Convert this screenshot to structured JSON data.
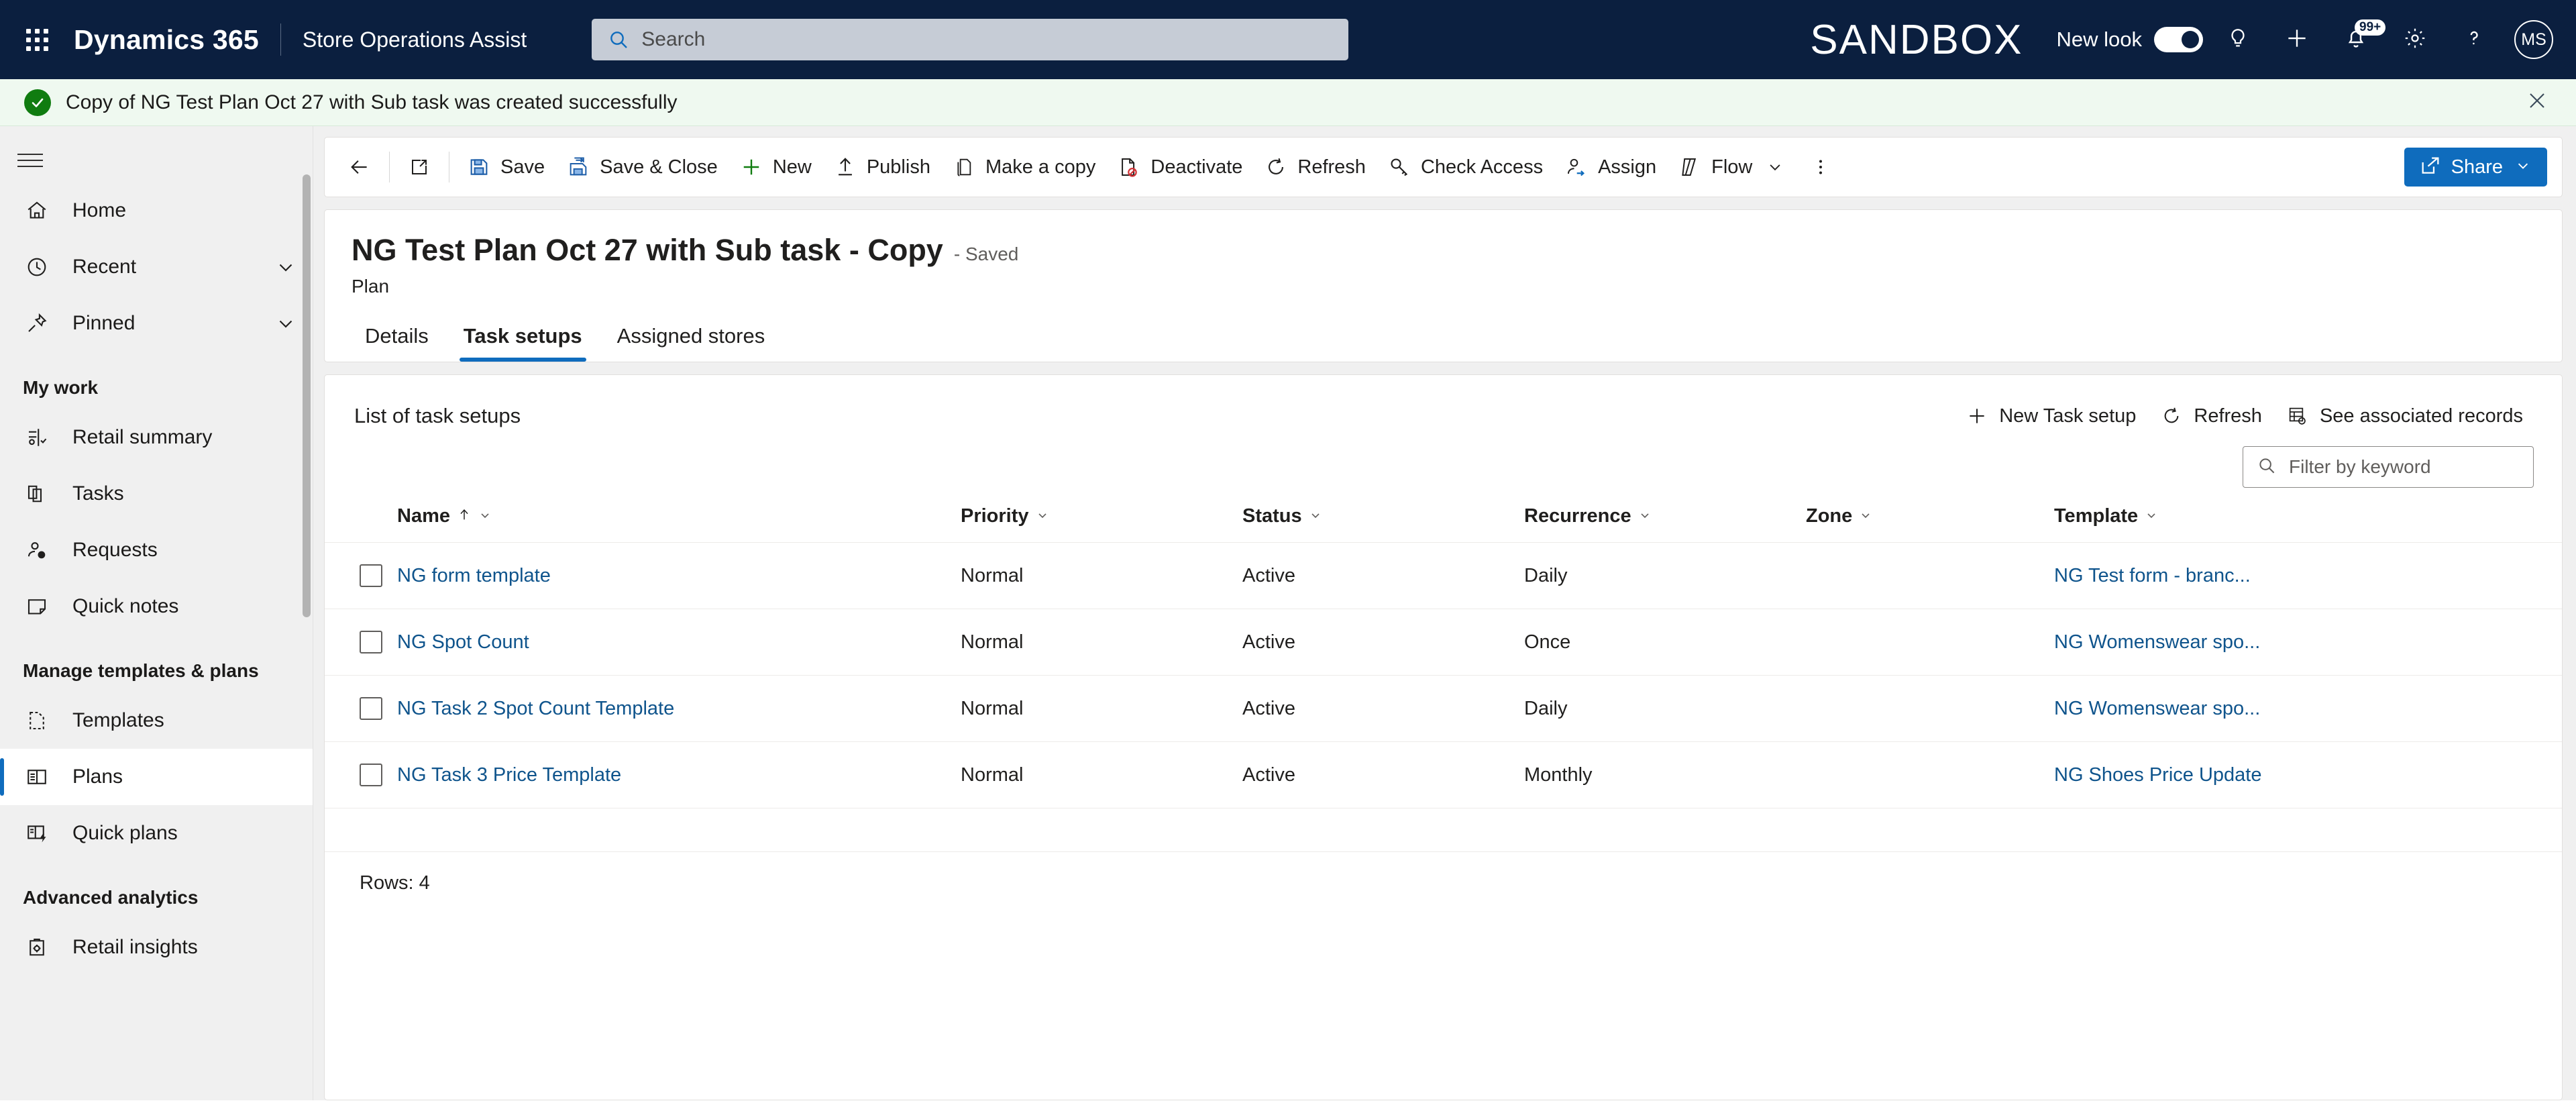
{
  "topnav": {
    "waffle_label": "app-launcher",
    "brand": "Dynamics 365",
    "app_name": "Store Operations Assist",
    "search_placeholder": "Search",
    "search_value": "",
    "environment_label": "SANDBOX",
    "new_look_label": "New look",
    "new_look_state": "on",
    "notification_badge": "99+",
    "avatar_initials": "MS",
    "accent_color": "#0f6cbd",
    "bar_color": "#0b1f3f"
  },
  "notification": {
    "message": "Copy of NG Test Plan Oct 27 with Sub task was created successfully",
    "type": "success",
    "success_color": "#107c10",
    "background_color": "#eff9f0"
  },
  "sidebar": {
    "groups": [
      {
        "title": "",
        "items": [
          {
            "label": "Home",
            "icon": "home-icon",
            "expandable": false,
            "selected": false
          },
          {
            "label": "Recent",
            "icon": "clock-icon",
            "expandable": true,
            "selected": false
          },
          {
            "label": "Pinned",
            "icon": "pin-icon",
            "expandable": true,
            "selected": false
          }
        ]
      },
      {
        "title": "My work",
        "items": [
          {
            "label": "Retail summary",
            "icon": "chart-icon",
            "expandable": false,
            "selected": false
          },
          {
            "label": "Tasks",
            "icon": "copy-pages-icon",
            "expandable": false,
            "selected": false
          },
          {
            "label": "Requests",
            "icon": "person-question-icon",
            "expandable": false,
            "selected": false
          },
          {
            "label": "Quick notes",
            "icon": "note-icon",
            "expandable": false,
            "selected": false
          }
        ]
      },
      {
        "title": "Manage templates & plans",
        "items": [
          {
            "label": "Templates",
            "icon": "template-dashed-icon",
            "expandable": false,
            "selected": false
          },
          {
            "label": "Plans",
            "icon": "plan-grid-icon",
            "expandable": false,
            "selected": true
          },
          {
            "label": "Quick plans",
            "icon": "quick-plan-icon",
            "expandable": false,
            "selected": false
          }
        ]
      },
      {
        "title": "Advanced analytics",
        "items": [
          {
            "label": "Retail insights",
            "icon": "clipboard-gear-icon",
            "expandable": false,
            "selected": false
          }
        ]
      }
    ]
  },
  "commandbar": {
    "back_label": "Back",
    "popout_label": "Open in new window",
    "buttons": [
      {
        "label": "Save",
        "icon": "save-icon"
      },
      {
        "label": "Save & Close",
        "icon": "save-close-icon"
      },
      {
        "label": "New",
        "icon": "plus-icon"
      },
      {
        "label": "Publish",
        "icon": "publish-icon"
      },
      {
        "label": "Make a copy",
        "icon": "copy-icon"
      },
      {
        "label": "Deactivate",
        "icon": "deactivate-icon"
      },
      {
        "label": "Refresh",
        "icon": "refresh-icon"
      },
      {
        "label": "Check Access",
        "icon": "key-icon"
      },
      {
        "label": "Assign",
        "icon": "assign-person-icon"
      },
      {
        "label": "Flow",
        "icon": "flow-icon",
        "has_chevron": true
      }
    ],
    "overflow_label": "More commands",
    "share_label": "Share"
  },
  "record": {
    "title": "NG Test Plan Oct 27 with Sub task - Copy",
    "saved_state": "- Saved",
    "entity": "Plan",
    "tabs": [
      {
        "label": "Details",
        "active": false
      },
      {
        "label": "Task setups",
        "active": true
      },
      {
        "label": "Assigned stores",
        "active": false
      }
    ]
  },
  "grid": {
    "title": "List of task setups",
    "actions": [
      {
        "label": "New Task setup",
        "icon": "plus-icon"
      },
      {
        "label": "Refresh",
        "icon": "refresh-icon"
      },
      {
        "label": "See associated records",
        "icon": "associated-records-icon"
      }
    ],
    "filter_placeholder": "Filter by keyword",
    "filter_value": "",
    "columns": [
      {
        "label": "Name",
        "sorted": "asc",
        "menu": true
      },
      {
        "label": "Priority",
        "sorted": "",
        "menu": true
      },
      {
        "label": "Status",
        "sorted": "",
        "menu": true
      },
      {
        "label": "Recurrence",
        "sorted": "",
        "menu": true
      },
      {
        "label": "Zone",
        "sorted": "",
        "menu": true
      },
      {
        "label": "Template",
        "sorted": "",
        "menu": true
      }
    ],
    "rows": [
      {
        "selected": false,
        "name": "NG form template",
        "priority": "Normal",
        "status": "Active",
        "recurrence": "Daily",
        "zone": "",
        "template": "NG Test form - branc..."
      },
      {
        "selected": false,
        "name": "NG Spot Count",
        "priority": "Normal",
        "status": "Active",
        "recurrence": "Once",
        "zone": "",
        "template": "NG Womenswear spo..."
      },
      {
        "selected": false,
        "name": "NG Task 2 Spot Count Template",
        "priority": "Normal",
        "status": "Active",
        "recurrence": "Daily",
        "zone": "",
        "template": "NG Womenswear spo..."
      },
      {
        "selected": false,
        "name": "NG Task 3 Price Template",
        "priority": "Normal",
        "status": "Active",
        "recurrence": "Monthly",
        "zone": "",
        "template": "NG Shoes Price Update"
      }
    ],
    "row_count_label": "Rows: 4",
    "link_color": "#0f548c"
  }
}
